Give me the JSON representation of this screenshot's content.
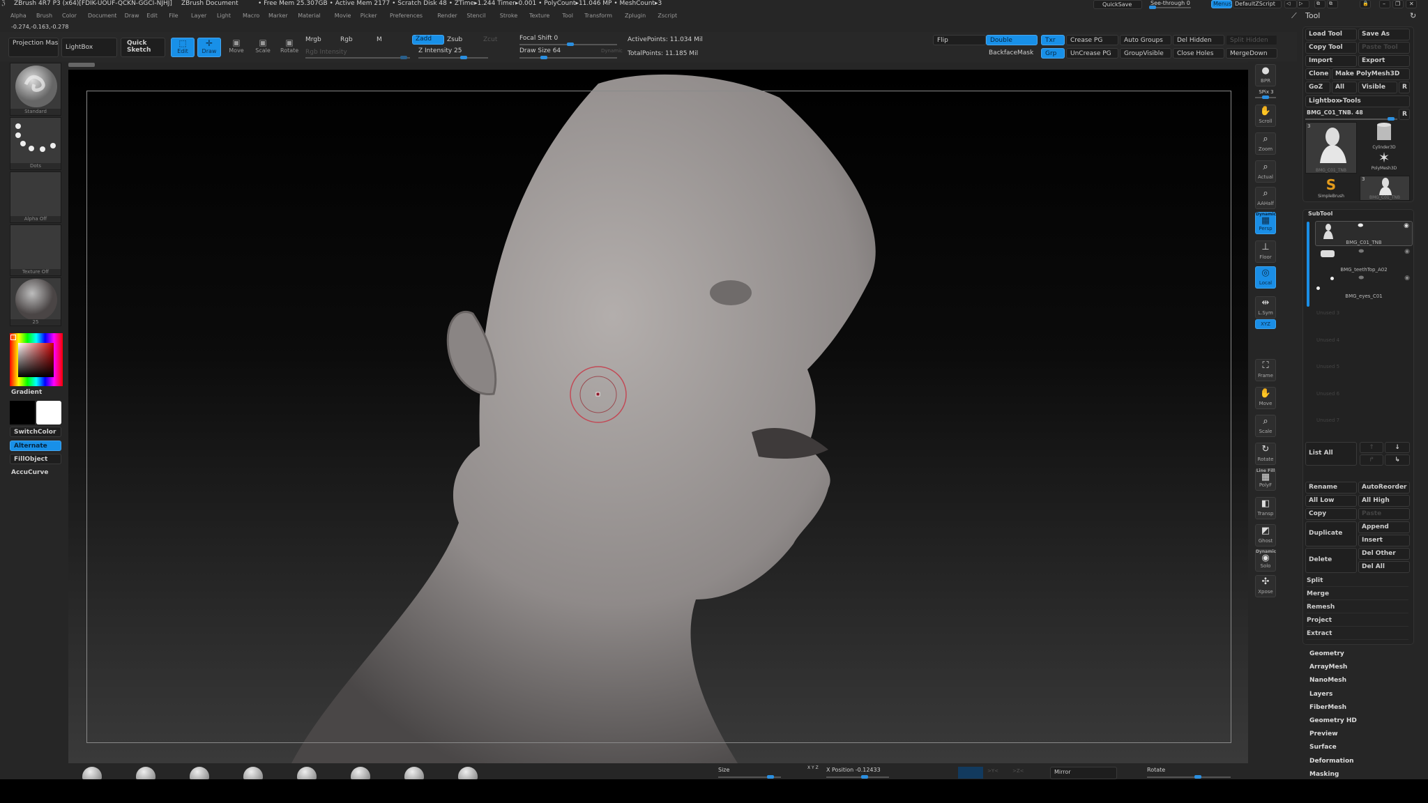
{
  "window": {
    "title": "ZBrush 4R7 P3 (x64)[FDIK-UOUF-QCKN-GGCI-NJHJ]",
    "document": "ZBrush Document",
    "status": "• Free Mem 25.307GB • Active Mem 2177 • Scratch Disk 48 •  ZTime▸1.244 Timer▸0.001 • PolyCount▸11.046 MP  • MeshCount▸3",
    "quicksave": "QuickSave",
    "see_through": "See-through  0",
    "see_through_value": 0,
    "menus": "Menus",
    "default_zscript": "DefaultZScript"
  },
  "menubar": [
    "Alpha",
    "Brush",
    "Color",
    "Document",
    "Draw",
    "Edit",
    "File",
    "Layer",
    "Light",
    "Macro",
    "Marker",
    "Material",
    "Movie",
    "Picker",
    "Preferences",
    "Render",
    "Stencil",
    "Stroke",
    "Texture",
    "Tool",
    "Transform",
    "Zplugin",
    "Zscript"
  ],
  "coords": "-0.274,-0.163,-0.278",
  "shelf": {
    "projection_master": "Projection Master",
    "lightbox": "LightBox",
    "quick_sketch": "Quick Sketch",
    "edit": "Edit",
    "draw": "Draw",
    "move": "Move",
    "scale": "Scale",
    "rotate": "Rotate",
    "mrgb": "Mrgb",
    "rgb": "Rgb",
    "m": "M",
    "rgb_intensity": "Rgb Intensity",
    "zadd": "Zadd",
    "zsub": "Zsub",
    "zcut": "Zcut",
    "z_intensity": "Z Intensity 25",
    "z_intensity_value": 25,
    "focal_shift": "Focal Shift 0",
    "focal_shift_value": 0,
    "draw_size": "Draw Size 64",
    "draw_size_value": 64,
    "dynamic": "Dynamic",
    "active_points": "ActivePoints: 11.034  Mil",
    "total_points": "TotalPoints: 11.185  Mil",
    "flip": "Flip",
    "double": "Double",
    "txr": "Txr",
    "crease_pg": "Crease PG",
    "auto_groups": "Auto Groups",
    "del_hidden": "Del Hidden",
    "split_hidden": "Split Hidden",
    "backface_mask": "BackfaceMask",
    "grp": "Grp",
    "uncrease_pg": "UnCrease PG",
    "group_visible": "GroupVisible",
    "close_holes": "Close Holes",
    "merge_down": "MergeDown"
  },
  "left": {
    "brush": "Standard",
    "stroke": "Dots",
    "alpha": "Alpha Off",
    "texture": "Texture Off",
    "material": "25",
    "gradient": "Gradient",
    "switch_color": "SwitchColor",
    "alternate": "Alternate",
    "fill_object": "FillObject",
    "accucurve": "AccuCurve",
    "primary_color": "#000000",
    "secondary_color": "#ffffff"
  },
  "right_shelf": [
    {
      "label": "BPR",
      "icon": "bpr-sphere-icon"
    },
    {
      "label": "SPix 3",
      "icon": "spix-slider"
    },
    {
      "label": "Scroll",
      "icon": "hand-icon"
    },
    {
      "label": "Zoom",
      "icon": "magnifier-icon"
    },
    {
      "label": "Actual",
      "icon": "magnifier-icon"
    },
    {
      "label": "AAHalf",
      "icon": "magnifier-icon"
    },
    {
      "label": "Persp",
      "top": "Dynamic",
      "icon": "perspective-grid-icon",
      "active": true
    },
    {
      "label": "Floor",
      "icon": "floor-icon"
    },
    {
      "label": "Local",
      "icon": "local-icon",
      "active": true
    },
    {
      "label": "L.Sym",
      "icon": "symmetry-icon"
    },
    {
      "label": "XYZ",
      "icon": "xyz-rotate-icon",
      "active": true
    },
    {
      "label": "Frame",
      "icon": "frame-icon"
    },
    {
      "label": "Move",
      "icon": "hand-icon"
    },
    {
      "label": "Scale",
      "icon": "magnifier-icon"
    },
    {
      "label": "Rotate",
      "icon": "rotate-icon"
    },
    {
      "label": "PolyF",
      "top": "Line Fill",
      "icon": "polyframe-icon"
    },
    {
      "label": "Transp",
      "icon": "transparency-icon"
    },
    {
      "label": "Ghost",
      "icon": "ghost-icon"
    },
    {
      "label": "Solo",
      "top": "Dynamic",
      "icon": "solo-icon"
    },
    {
      "label": "Xpose",
      "icon": "xpose-icon"
    }
  ],
  "tool": {
    "title": "Tool",
    "load_tool": "Load Tool",
    "save_as": "Save As",
    "copy_tool": "Copy Tool",
    "paste_tool": "Paste Tool",
    "import": "Import",
    "export": "Export",
    "clone": "Clone",
    "make_polymesh": "Make PolyMesh3D",
    "goz": "GoZ",
    "all": "All",
    "visible": "Visible",
    "r": "R",
    "lightbox_tools": "Lightbox▸Tools",
    "current_tool": "BMG_C01_TNB. 48",
    "thumbs": [
      {
        "name": "BMG_C01_TNB",
        "count": "3"
      },
      {
        "name": "Cylinder3D"
      },
      {
        "name": "PolyMesh3D"
      },
      {
        "name": "SimpleBrush"
      },
      {
        "name": "BMG_C01_TNB",
        "count": "3"
      }
    ]
  },
  "subtool": {
    "title": "SubTool",
    "items": [
      "BMG_C01_TNB",
      "BMG_teethTop_A02",
      "BMG_eyes_C01"
    ],
    "unused": [
      "Unused 3",
      "Unused 4",
      "Unused 5",
      "Unused 6",
      "Unused 7"
    ],
    "list_all": "List All",
    "rename": "Rename",
    "auto_reorder": "AutoReorder",
    "all_low": "All Low",
    "all_high": "All High",
    "copy": "Copy",
    "paste": "Paste",
    "duplicate": "Duplicate",
    "append": "Append",
    "insert": "Insert",
    "delete": "Delete",
    "del_other": "Del Other",
    "del_all": "Del All",
    "actions": [
      "Split",
      "Merge",
      "Remesh",
      "Project",
      "Extract"
    ]
  },
  "tool_sections": [
    "Geometry",
    "ArrayMesh",
    "NanoMesh",
    "Layers",
    "FiberMesh",
    "Geometry HD",
    "Preview",
    "Surface",
    "Deformation",
    "Masking"
  ],
  "bottom": {
    "size": "Size",
    "xyz": "X Y Z",
    "x_position": "X Position -0.12433",
    "mirror": "Mirror",
    "rotate": "Rotate"
  }
}
